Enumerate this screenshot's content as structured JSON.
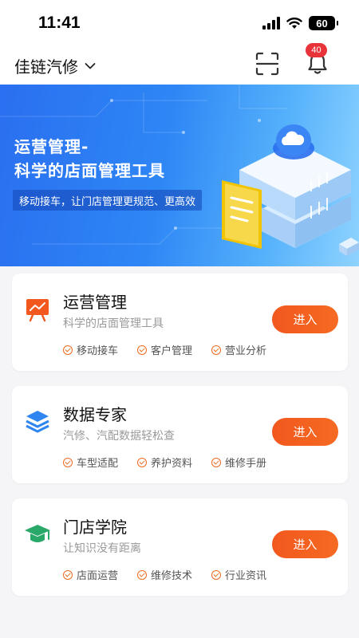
{
  "status_bar": {
    "time": "11:41",
    "battery": "60"
  },
  "header": {
    "store_name": "佳链汽修",
    "notification_count": "40",
    "icons": [
      "chevron-down-icon",
      "scan-icon",
      "bell-icon"
    ]
  },
  "banner": {
    "title_line1": "运营管理-",
    "title_line2": "科学的店面管理工具",
    "subtitle": "移动接车，让门店管理更规范、更高效"
  },
  "cards": [
    {
      "title": "运营管理",
      "subtitle": "科学的店面管理工具",
      "features": [
        "移动接车",
        "客户管理",
        "营业分析"
      ],
      "button": "进入",
      "icon": "presentation-board-icon"
    },
    {
      "title": "数据专家",
      "subtitle": "汽修、汽配数据轻松查",
      "features": [
        "车型适配",
        "养护资料",
        "维修手册"
      ],
      "button": "进入",
      "icon": "layers-icon"
    },
    {
      "title": "门店学院",
      "subtitle": "让知识没有距离",
      "features": [
        "店面运营",
        "维修技术",
        "行业资讯"
      ],
      "button": "进入",
      "icon": "graduation-cap-icon"
    }
  ],
  "colors": {
    "accent": "#f2581e",
    "badge": "#e8333a",
    "banner_blue": "#2e86f5",
    "icon_blue": "#2f86f0",
    "icon_green": "#2aa86a"
  }
}
